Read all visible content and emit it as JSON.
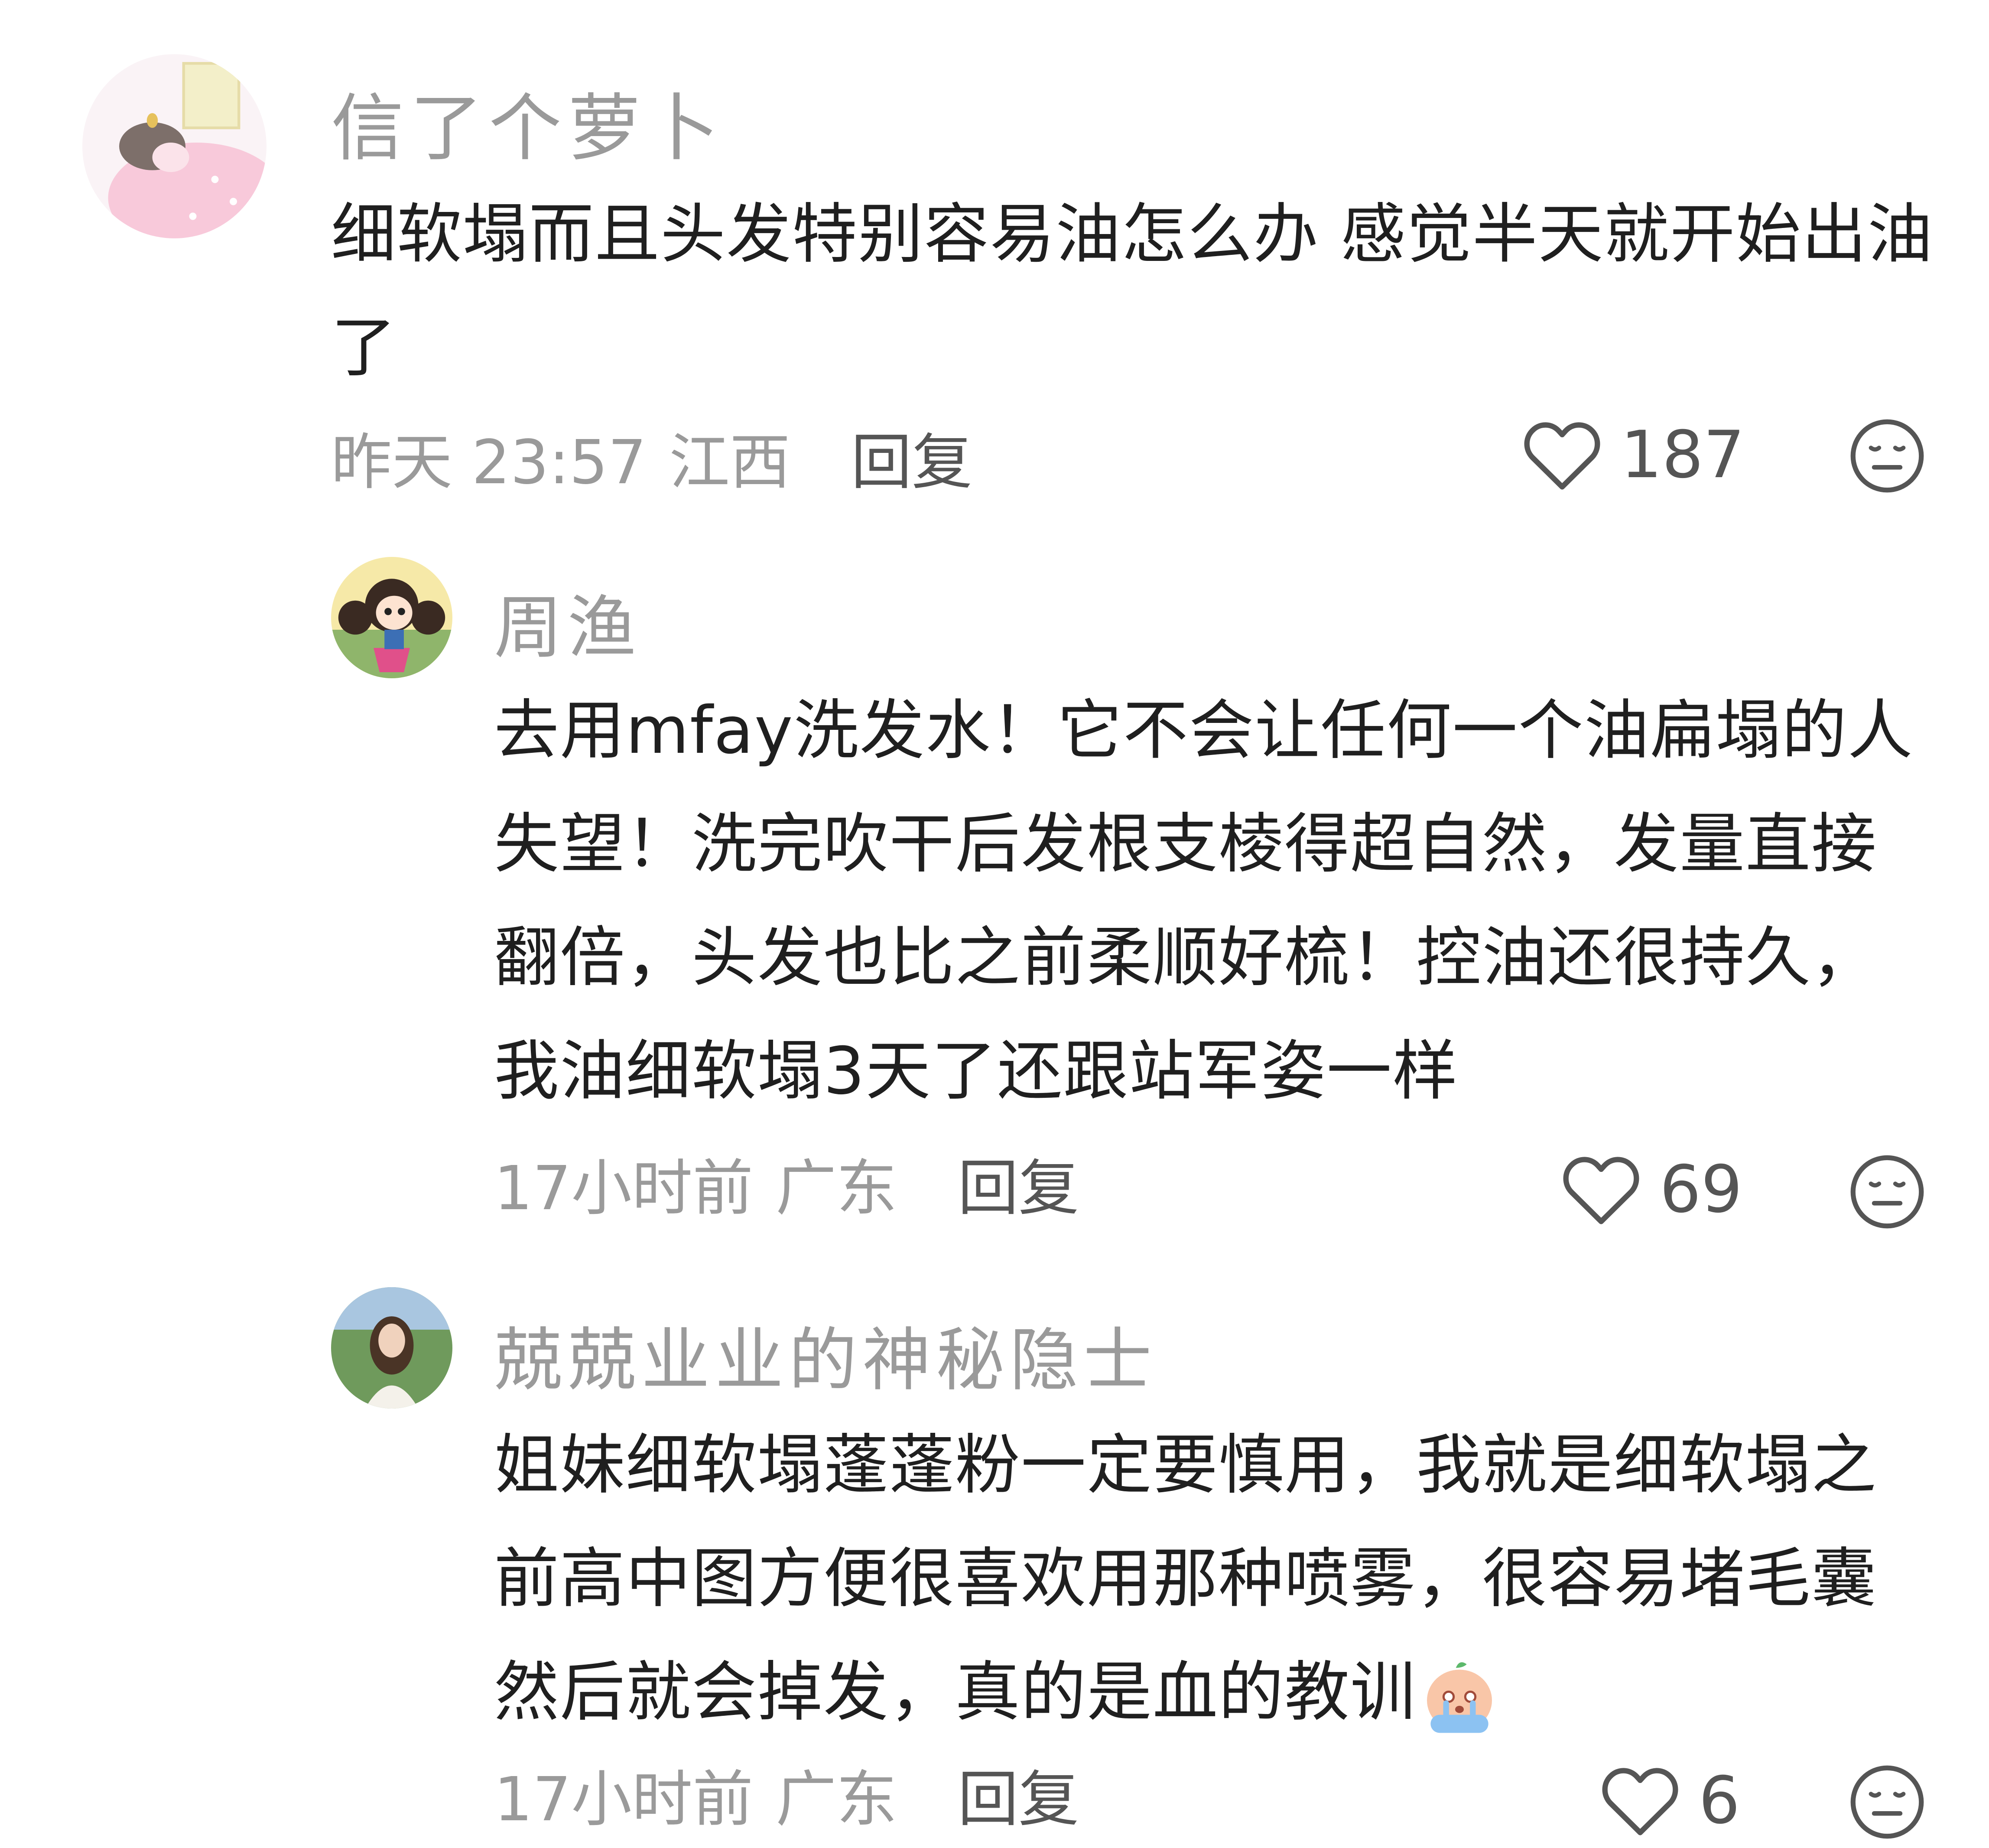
{
  "comments": [
    {
      "username": "信了个萝卜",
      "text": "细软塌而且头发特别容易油怎么办 感觉半天就开始出油了",
      "time": "昨天 23:57",
      "location": "江西",
      "reply_label": "回复",
      "likes": "187",
      "avatar_icon": "sleeping-girl-avatar"
    },
    {
      "username": "周渔",
      "text": "去用mfay洗发水！它不会让任何一个油扁塌的人失望！洗完吹干后发根支棱得超自然，发量直接翻倍，头发也比之前柔顺好梳！控油还很持久，我油细软塌3天了还跟站军姿一样",
      "time": "17小时前",
      "location": "广东",
      "reply_label": "回复",
      "likes": "69",
      "avatar_icon": "cartoon-girl-avatar"
    },
    {
      "username": "兢兢业业的神秘隐士",
      "text": "姐妹细软塌蓬蓬粉一定要慎用，我就是细软塌之前高中图方便很喜欢用那种喷雾，很容易堵毛囊然后就会掉发，真的是血的教训",
      "time": "17小时前",
      "location": "广东",
      "reply_label": "回复",
      "likes": "6",
      "avatar_icon": "photo-woman-avatar",
      "trailing_emoji": "crying-peach-emoji"
    }
  ],
  "icons": {
    "like": "heart-outline-icon",
    "dislike": "neutral-face-icon"
  },
  "colors": {
    "username": "#9a9a9a",
    "body": "#1f1f1f",
    "meta": "#9a9a9a",
    "reply": "#555555",
    "icon": "#555555"
  }
}
